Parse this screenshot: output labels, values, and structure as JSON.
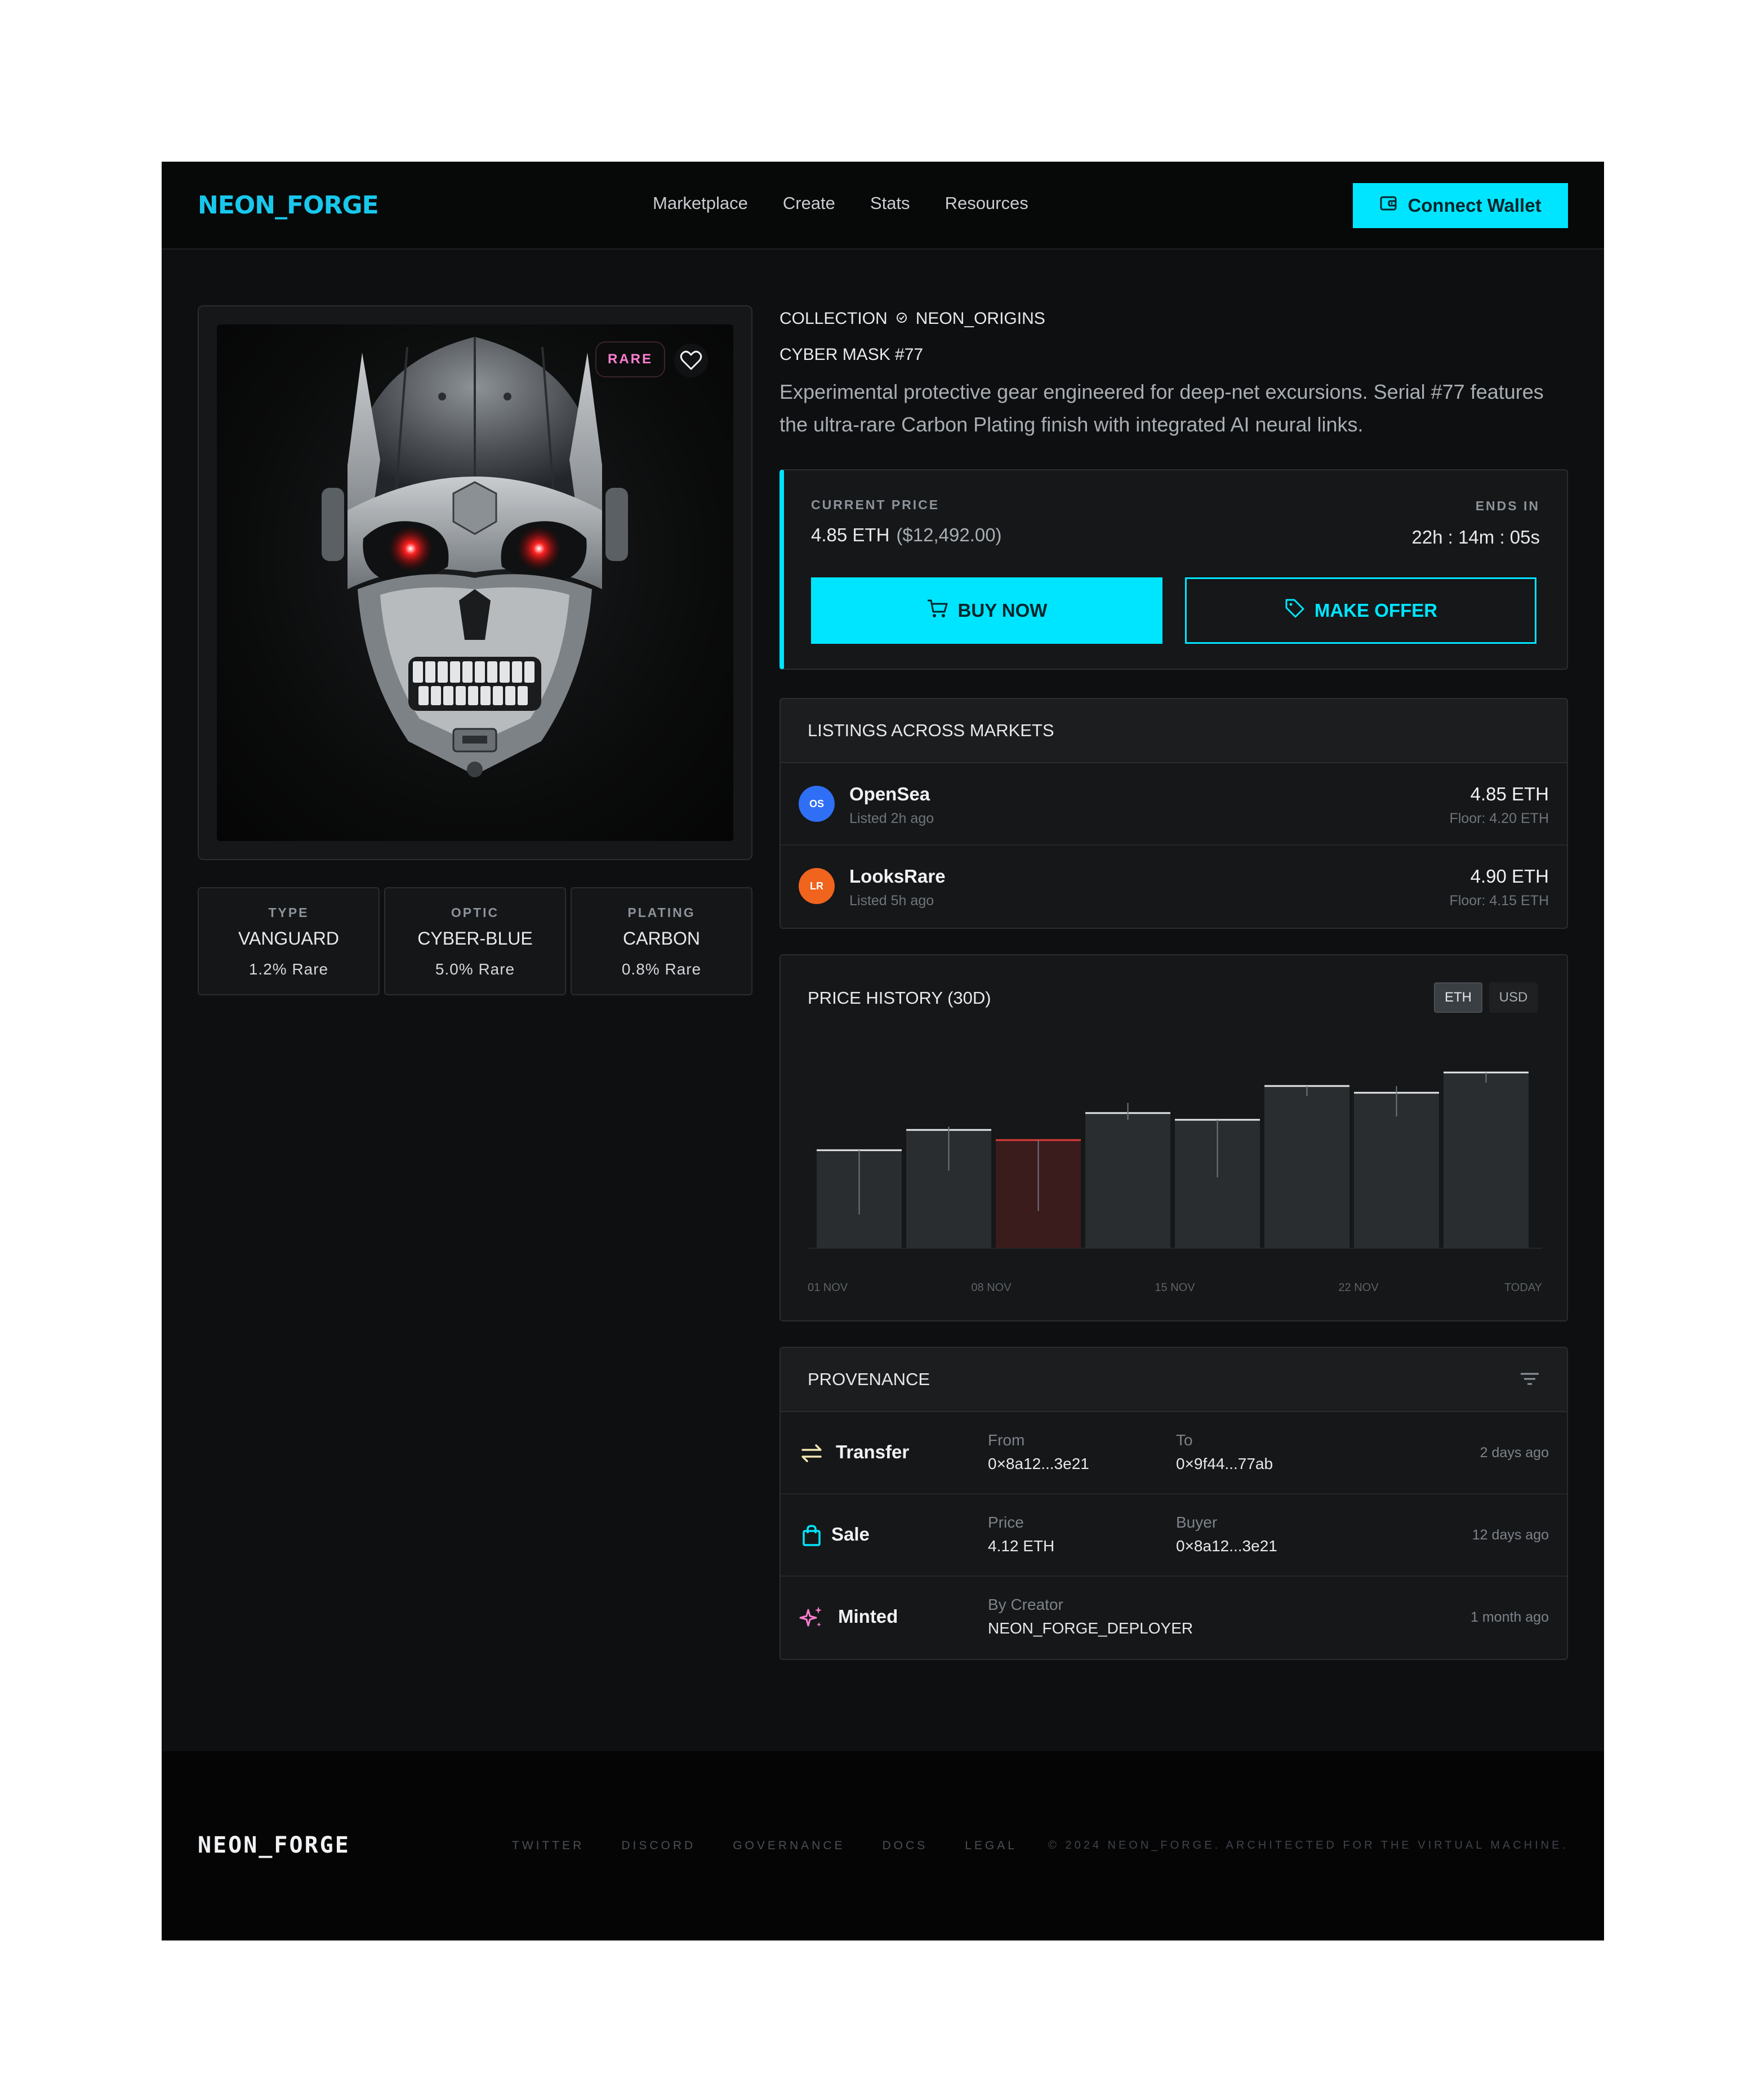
{
  "header": {
    "brand": "NEON_FORGE",
    "nav": [
      "Marketplace",
      "Create",
      "Stats",
      "Resources"
    ],
    "connect_label": "Connect Wallet"
  },
  "artwork": {
    "rare_badge": "RARE"
  },
  "traits": [
    {
      "label": "TYPE",
      "value": "VANGUARD",
      "rarity": "1.2% Rare"
    },
    {
      "label": "OPTIC",
      "value": "CYBER-BLUE",
      "rarity": "5.0% Rare"
    },
    {
      "label": "PLATING",
      "value": "CARBON",
      "rarity": "0.8% Rare"
    }
  ],
  "item": {
    "collection_prefix": "COLLECTION",
    "collection_name": "NEON_ORIGINS",
    "title": "CYBER MASK #77",
    "description": "Experimental protective gear engineered for deep-net excursions. Serial #77 features the ultra-rare Carbon Plating finish with integrated AI neural links."
  },
  "price": {
    "label": "CURRENT PRICE",
    "eth": "4.85 ETH",
    "usd": "($12,492.00)",
    "ends_label": "ENDS IN",
    "ends_value": "22h : 14m : 05s",
    "buy_label": "BUY NOW",
    "offer_label": "MAKE OFFER"
  },
  "listings": {
    "title": "LISTINGS ACROSS MARKETS",
    "rows": [
      {
        "badge": "OS",
        "name": "OpenSea",
        "sub": "Listed 2h ago",
        "price": "4.85 ETH",
        "floor": "Floor: 4.20 ETH",
        "color": "#2f6ff5"
      },
      {
        "badge": "LR",
        "name": "LooksRare",
        "sub": "Listed 5h ago",
        "price": "4.90 ETH",
        "floor": "Floor: 4.15 ETH",
        "color": "#f0641e"
      }
    ]
  },
  "history": {
    "title": "PRICE HISTORY (30D)",
    "toggle_eth": "ETH",
    "toggle_usd": "USD"
  },
  "chart_data": {
    "type": "bar",
    "title": "PRICE HISTORY (30D)",
    "x_tick_labels": [
      "01 NOV",
      "08 NOV",
      "15 NOV",
      "22 NOV",
      "TODAY"
    ],
    "values": [
      2.9,
      3.5,
      3.2,
      4.0,
      3.8,
      4.8,
      4.6,
      5.2
    ],
    "wick_high": [
      2.9,
      3.6,
      3.2,
      4.3,
      3.8,
      4.8,
      4.8,
      5.2
    ],
    "wick_low": [
      1.0,
      2.3,
      1.1,
      3.8,
      2.1,
      4.5,
      3.9,
      4.9
    ],
    "highlight": [
      false,
      false,
      true,
      false,
      false,
      false,
      false,
      false
    ],
    "ylim": [
      0,
      6
    ]
  },
  "provenance": {
    "title": "PROVENANCE",
    "rows": [
      {
        "event": "Transfer",
        "k1": "From",
        "v1": "0×8a12...3e21",
        "k2": "To",
        "v2": "0×9f44...77ab",
        "time": "2 days ago",
        "icon": "transfer-icon"
      },
      {
        "event": "Sale",
        "k1": "Price",
        "v1": "4.12 ETH",
        "k2": "Buyer",
        "v2": "0×8a12...3e21",
        "time": "12 days ago",
        "icon": "shopping-bag-icon"
      },
      {
        "event": "Minted",
        "k1": "By Creator",
        "v1": "NEON_FORGE_DEPLOYER",
        "k2": "",
        "v2": "",
        "time": "1 month ago",
        "icon": "sparkle-icon"
      }
    ]
  },
  "footer": {
    "brand": "NEON_FORGE",
    "links": [
      "TWITTER",
      "DISCORD",
      "GOVERNANCE",
      "DOCS",
      "LEGAL"
    ],
    "copyright": "© 2024 NEON_FORGE. ARCHITECTED FOR THE VIRTUAL MACHINE."
  },
  "colors": {
    "accent": "#00e5ff",
    "background": "#0e0f10",
    "rare": "#ff7fd0",
    "bar": "#2a2d2f",
    "bar_highlight": "#3a1c1d",
    "bar_top": "#e7e9ec",
    "bar_top_highlight": "#e23b3b"
  }
}
